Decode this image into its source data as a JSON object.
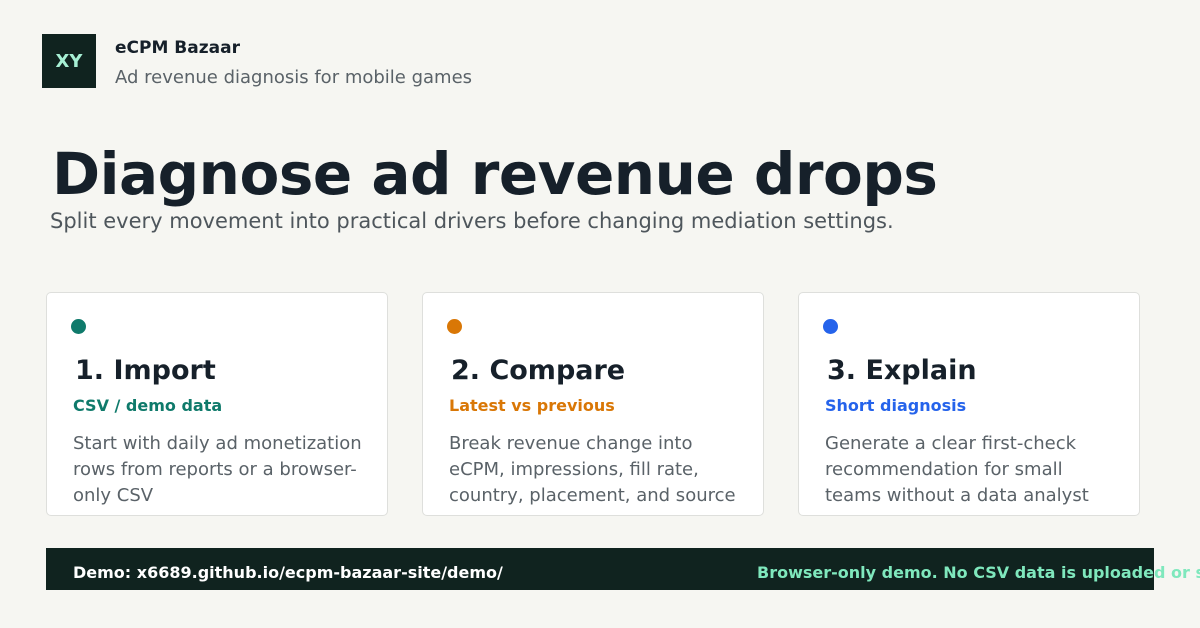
{
  "brand": {
    "logo_text": "XY",
    "name": "eCPM Bazaar",
    "tagline": "Ad revenue diagnosis for mobile games"
  },
  "hero": {
    "title": "Diagnose ad revenue drops",
    "subtitle": "Split every movement into practical drivers before changing mediation settings."
  },
  "cards": [
    {
      "title": "1. Import",
      "tag": "CSV / demo data",
      "accent": "#0f7a6b",
      "body": "Start with daily ad monetization rows from reports or a browser-only CSV"
    },
    {
      "title": "2. Compare",
      "tag": "Latest vs previous",
      "accent": "#d97706",
      "body": "Break revenue change into eCPM, impressions, fill rate, country, placement, and source"
    },
    {
      "title": "3. Explain",
      "tag": "Short diagnosis",
      "accent": "#2563eb",
      "body": "Generate a clear first-check recommendation for small teams without a data analyst"
    }
  ],
  "footer": {
    "demo": "Demo: x6689.github.io/ecpm-bazaar-site/demo/",
    "note": "Browser-only demo. No CSV data is uploaded or stored"
  },
  "colors": {
    "background": "#f6f6f2",
    "dark": "#10231f",
    "footer_note": "#7fe8bd"
  }
}
